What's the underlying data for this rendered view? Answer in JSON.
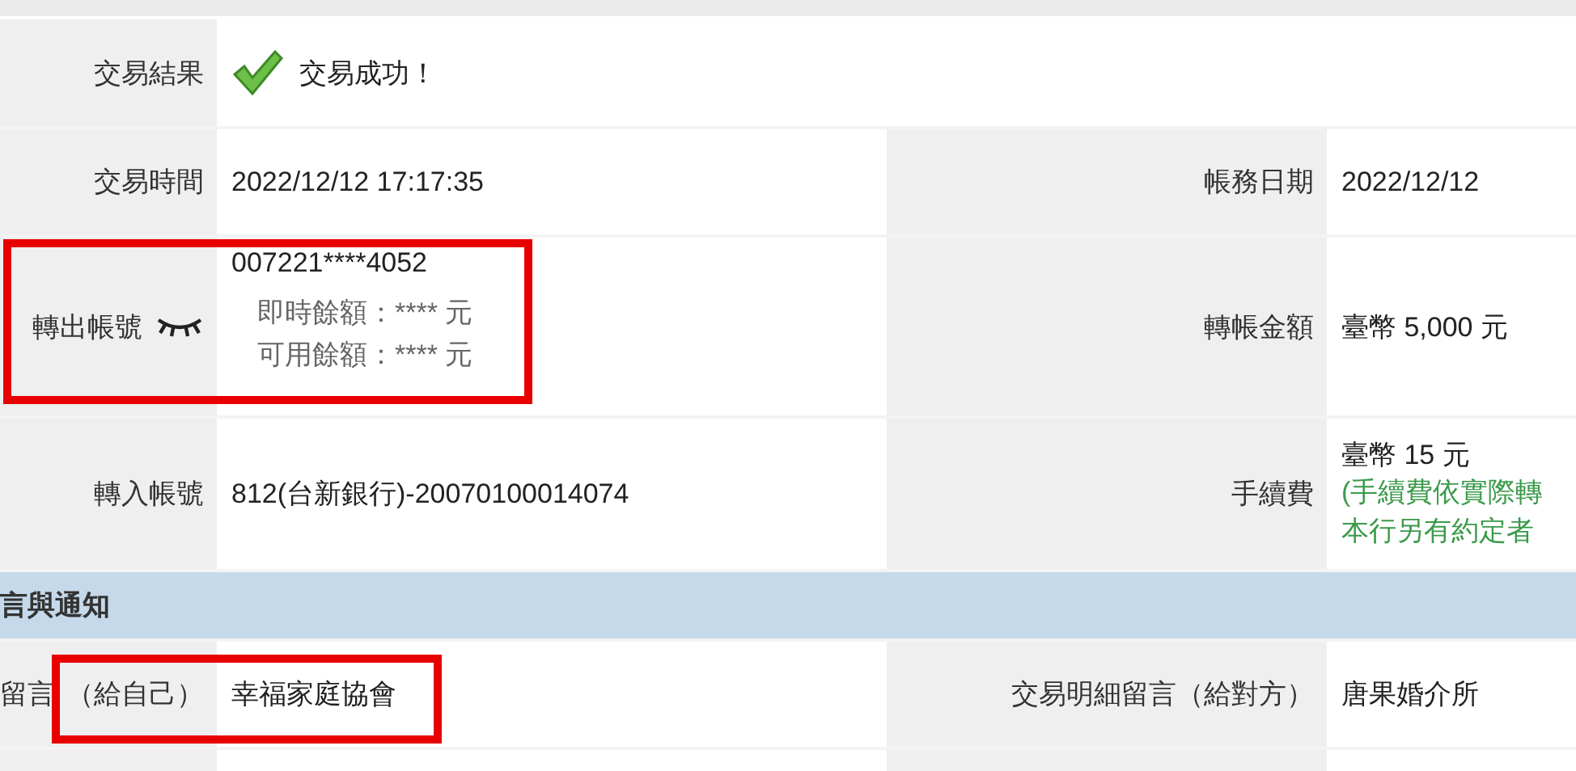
{
  "result": {
    "label": "交易結果",
    "value": "交易成功！",
    "success": true
  },
  "rows": [
    {
      "kind": "pair",
      "label": "交易時間",
      "value": "2022/12/12 17:17:35",
      "label2": "帳務日期",
      "value2": "2022/12/12"
    },
    {
      "kind": "account",
      "label": "轉出帳號",
      "balance_hidden": true,
      "highlighted": true,
      "value": "007221****4052",
      "balances": [
        "即時餘額：**** 元",
        "可用餘額：**** 元"
      ],
      "label2": "轉帳金額",
      "value2": "臺幣 5,000 元"
    },
    {
      "kind": "fee",
      "label": "轉入帳號",
      "value": "812(台新銀行)-20070100014074",
      "label2": "手續費",
      "value2": "臺幣 15 元",
      "notes": [
        "(手續費依實際轉",
        "本行另有約定者"
      ]
    }
  ],
  "section": {
    "title": "言與通知"
  },
  "memo": {
    "label_start": "留言",
    "label_end": "（給自己）",
    "highlighted": true,
    "value": "幸福家庭協會",
    "label2": "交易明細留言（給對方）",
    "value2": "唐果婚介所"
  }
}
